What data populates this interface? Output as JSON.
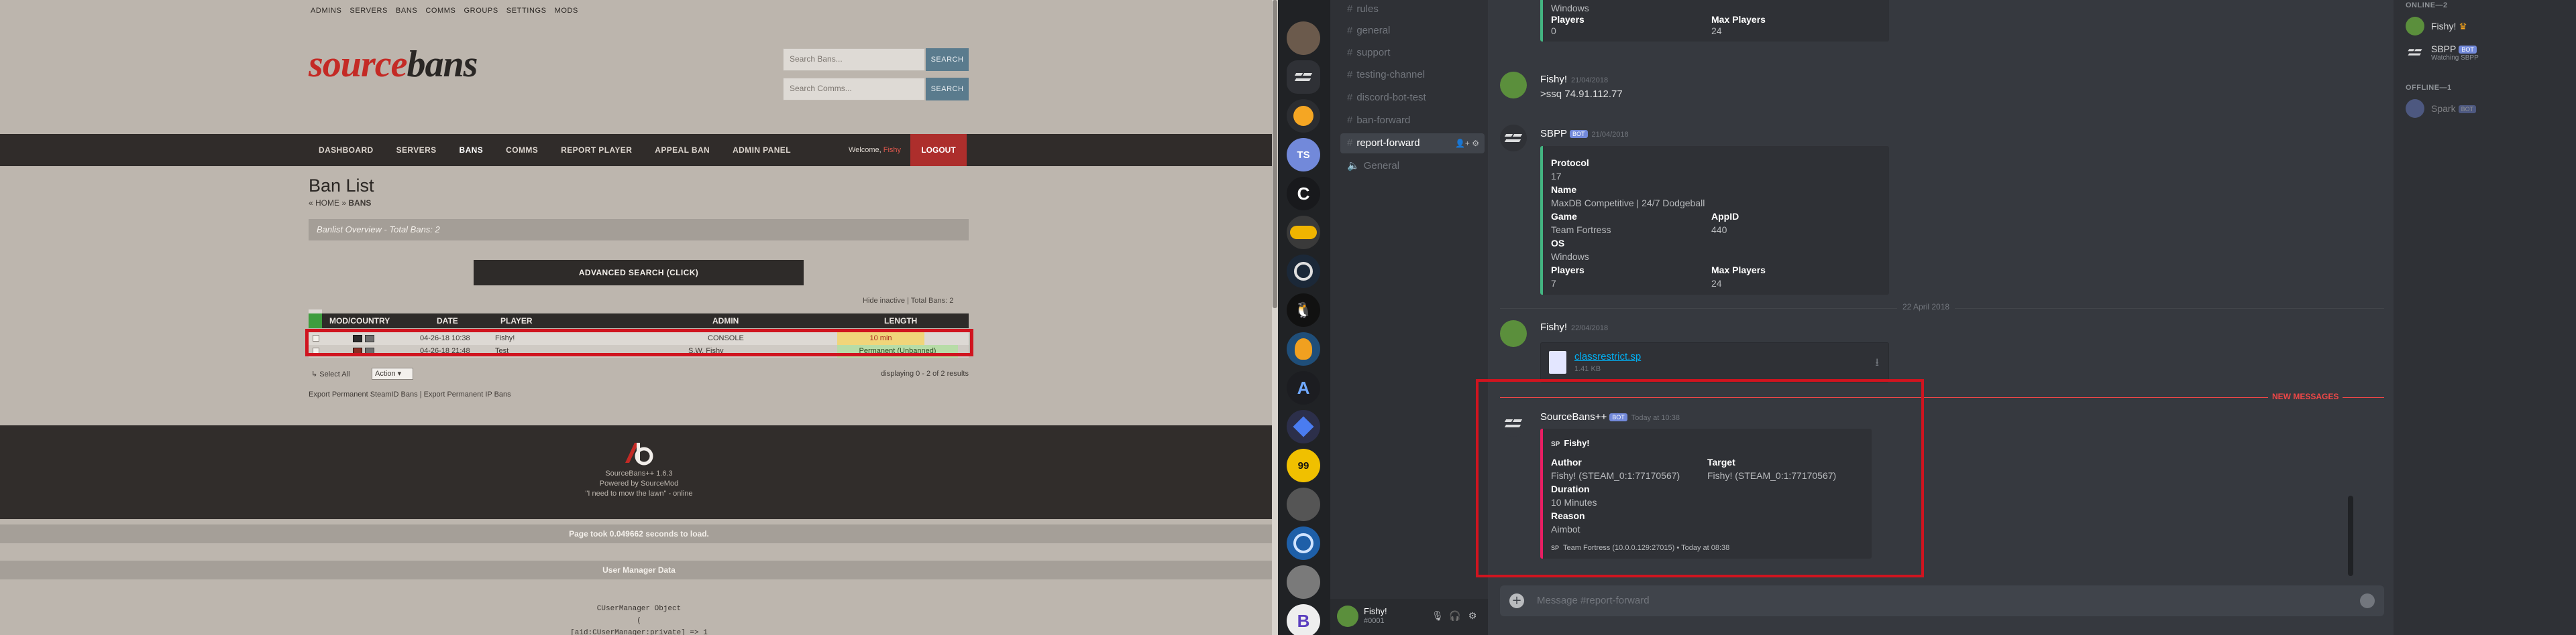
{
  "sourcebans": {
    "top_links": [
      "ADMINS",
      "SERVERS",
      "BANS",
      "COMMS",
      "GROUPS",
      "SETTINGS",
      "MODS"
    ],
    "logo": {
      "part1": "source",
      "part2": "bans"
    },
    "search_bans_placeholder": "Search Bans...",
    "search_comms_placeholder": "Search Comms...",
    "search_button": "SEARCH",
    "nav": [
      "DASHBOARD",
      "SERVERS",
      "BANS",
      "COMMS",
      "REPORT PLAYER",
      "APPEAL BAN",
      "ADMIN PANEL"
    ],
    "welcome_text": "Welcome,",
    "welcome_user": "Fishy",
    "logout": "LOGOUT",
    "page_title": "Ban List",
    "breadcrumb_home": "« HOME »",
    "breadcrumb_current": "BANS",
    "overview": "Banlist Overview - Total Bans: 2",
    "advanced_search": "ADVANCED SEARCH (CLICK)",
    "hide_inactive": "Hide inactive | Total Bans: 2",
    "columns": {
      "mod": "MOD/COUNTRY",
      "date": "DATE",
      "player": "PLAYER",
      "admin": "ADMIN",
      "length": "LENGTH"
    },
    "rows": [
      {
        "date": "04-26-18 10:38",
        "player": "Fishy!",
        "admin": "CONSOLE",
        "length": "10 min",
        "status": "active"
      },
      {
        "date": "04-26-18 21:48",
        "player": "Test",
        "admin": "S.W. Fishy",
        "length": "Permanent (Unbanned)",
        "status": "unbanned"
      }
    ],
    "select_all": "Select All",
    "action_select": "Action",
    "displaying": "displaying 0 - 2 of 2 results",
    "export": "Export Permanent SteamID Bans  |  Export Permanent IP Bans",
    "footer_version": "SourceBans++ 1.6.3",
    "footer_powered": "Powered by SourceMod",
    "footer_quote": "\"I need to mow the lawn\" - online",
    "page_load": "Page took 0.049662 seconds to load.",
    "user_manager": "User Manager Data",
    "dump_line1": "CUserManager Object",
    "dump_line2": "(",
    "dump_line3": "[aid:CUserManager:private] => 1"
  },
  "discord": {
    "channels_top_label": "rules",
    "channels": [
      "rules",
      "general",
      "support",
      "testing-channel",
      "discord-bot-test",
      "ban-forward",
      "report-forward",
      "General"
    ],
    "active_channel": "report-forward",
    "user": {
      "name": "Fishy!",
      "disc": "#0001"
    },
    "messages": {
      "m0": {
        "field1_label": "Windows",
        "f_players": "Players",
        "f_players_v": "0",
        "f_max": "Max Players",
        "f_max_v": "24"
      },
      "m1": {
        "author": "Fishy!",
        "time": "21/04/2018",
        "text": ">ssq 74.91.112.77"
      },
      "m2": {
        "author": "SBPP",
        "bot": "BOT",
        "time": "21/04/2018",
        "protocol_l": "Protocol",
        "protocol_v": "17",
        "name_l": "Name",
        "name_v": "MaxDB Competitive | 24/7 Dodgeball",
        "game_l": "Game",
        "game_v": "Team Fortress",
        "appid_l": "AppID",
        "appid_v": "440",
        "os_l": "OS",
        "os_v": "Windows",
        "players_l": "Players",
        "players_v": "7",
        "max_l": "Max Players",
        "max_v": "24"
      },
      "date_divider": "22 April 2018",
      "m3": {
        "author": "Fishy!",
        "time": "22/04/2018",
        "file": "classrestrict.sp",
        "size": "1.41 KB"
      },
      "new_messages": "NEW MESSAGES",
      "m4": {
        "author": "SourceBans++",
        "bot": "BOT",
        "time": "Today at 10:38",
        "embed_author": "Fishy!",
        "author_l": "Author",
        "author_v": "Fishy! (STEAM_0:1:77170567)",
        "target_l": "Target",
        "target_v": "Fishy! (STEAM_0:1:77170567)",
        "duration_l": "Duration",
        "duration_v": "10 Minutes",
        "reason_l": "Reason",
        "reason_v": "Aimbot",
        "footer": "Team Fortress (10.0.0.129:27015) • Today at 08:38"
      }
    },
    "input_placeholder": "Message #report-forward",
    "members": {
      "online_header": "ONLINE—2",
      "offline_header": "OFFLINE—1",
      "online": [
        {
          "name": "Fishy!",
          "crown": "♛"
        },
        {
          "name": "SBPP",
          "bot": "BOT",
          "status": "Watching SBPP"
        }
      ],
      "offline": [
        {
          "name": "Spark",
          "bot": "BOT"
        }
      ]
    },
    "colors": {
      "green": "#43b581",
      "pink": "#e91e63",
      "red": "#d0141f"
    }
  }
}
